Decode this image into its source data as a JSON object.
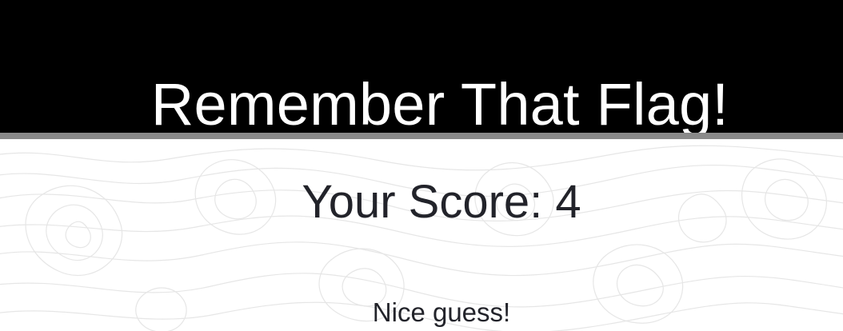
{
  "header": {
    "title": "Remember That Flag!"
  },
  "score": {
    "label": "Your Score:",
    "value": "4"
  },
  "feedback": {
    "message": "Nice guess!"
  },
  "colors": {
    "header_background": "#000000",
    "header_text": "#ffffff",
    "header_border": "#8a8a8a",
    "body_text": "#22232a",
    "pattern": "#e6e6e6"
  },
  "background": {
    "pattern": "topographic-contour-lines"
  }
}
